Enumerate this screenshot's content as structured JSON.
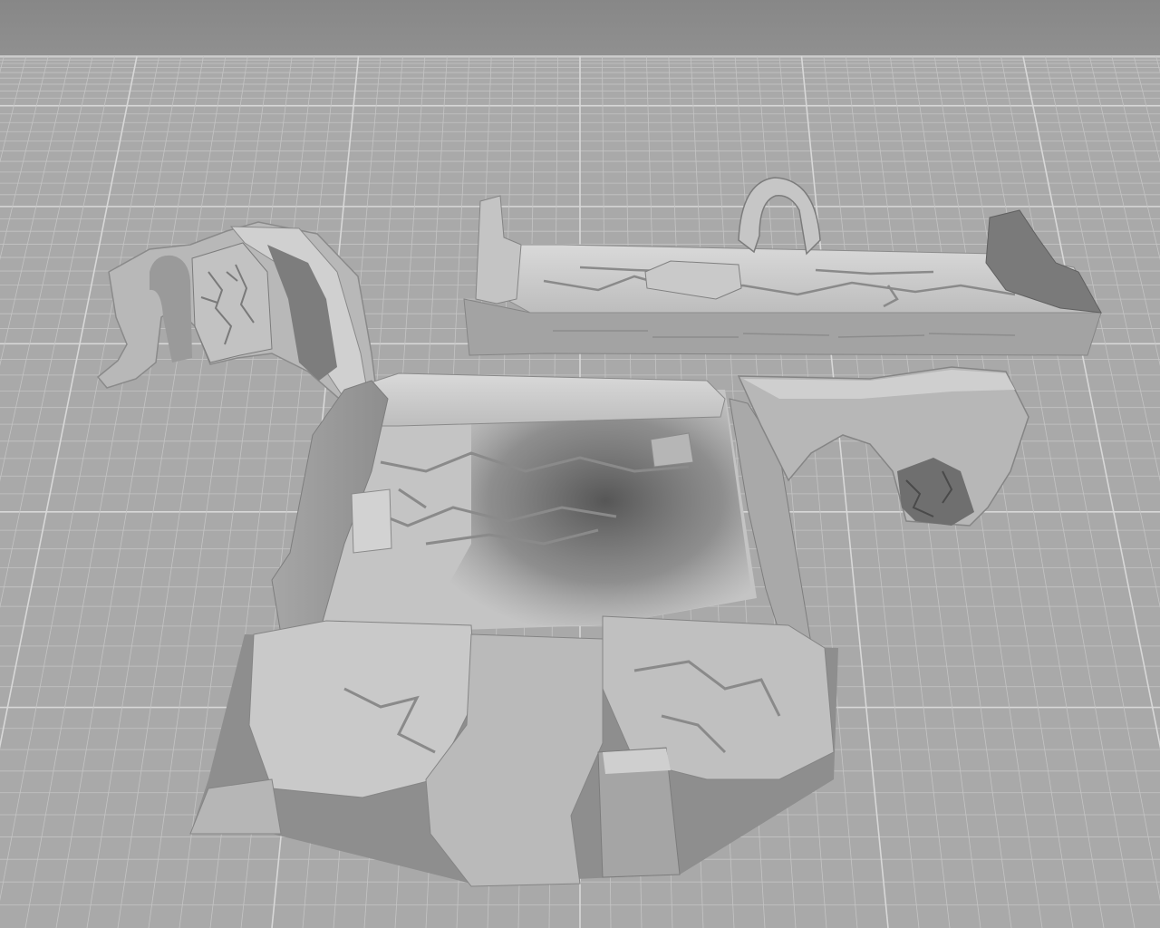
{
  "viewport": {
    "background_color": "#8c8c8c",
    "ground_color": "#a9a9a9",
    "grid_line_color": "#c4c4c4",
    "grid_major_color": "#d8d8d8",
    "model_light_color": "#d6d6d6",
    "model_mid_color": "#b4b4b4",
    "model_shadow_color": "#5e5e5e"
  },
  "scene": {
    "objects": [
      "ruined-arch-wall-fragment",
      "long-stone-floor-tile-with-arch",
      "square-ruined-room-tile",
      "broken-wall-fragment"
    ]
  }
}
